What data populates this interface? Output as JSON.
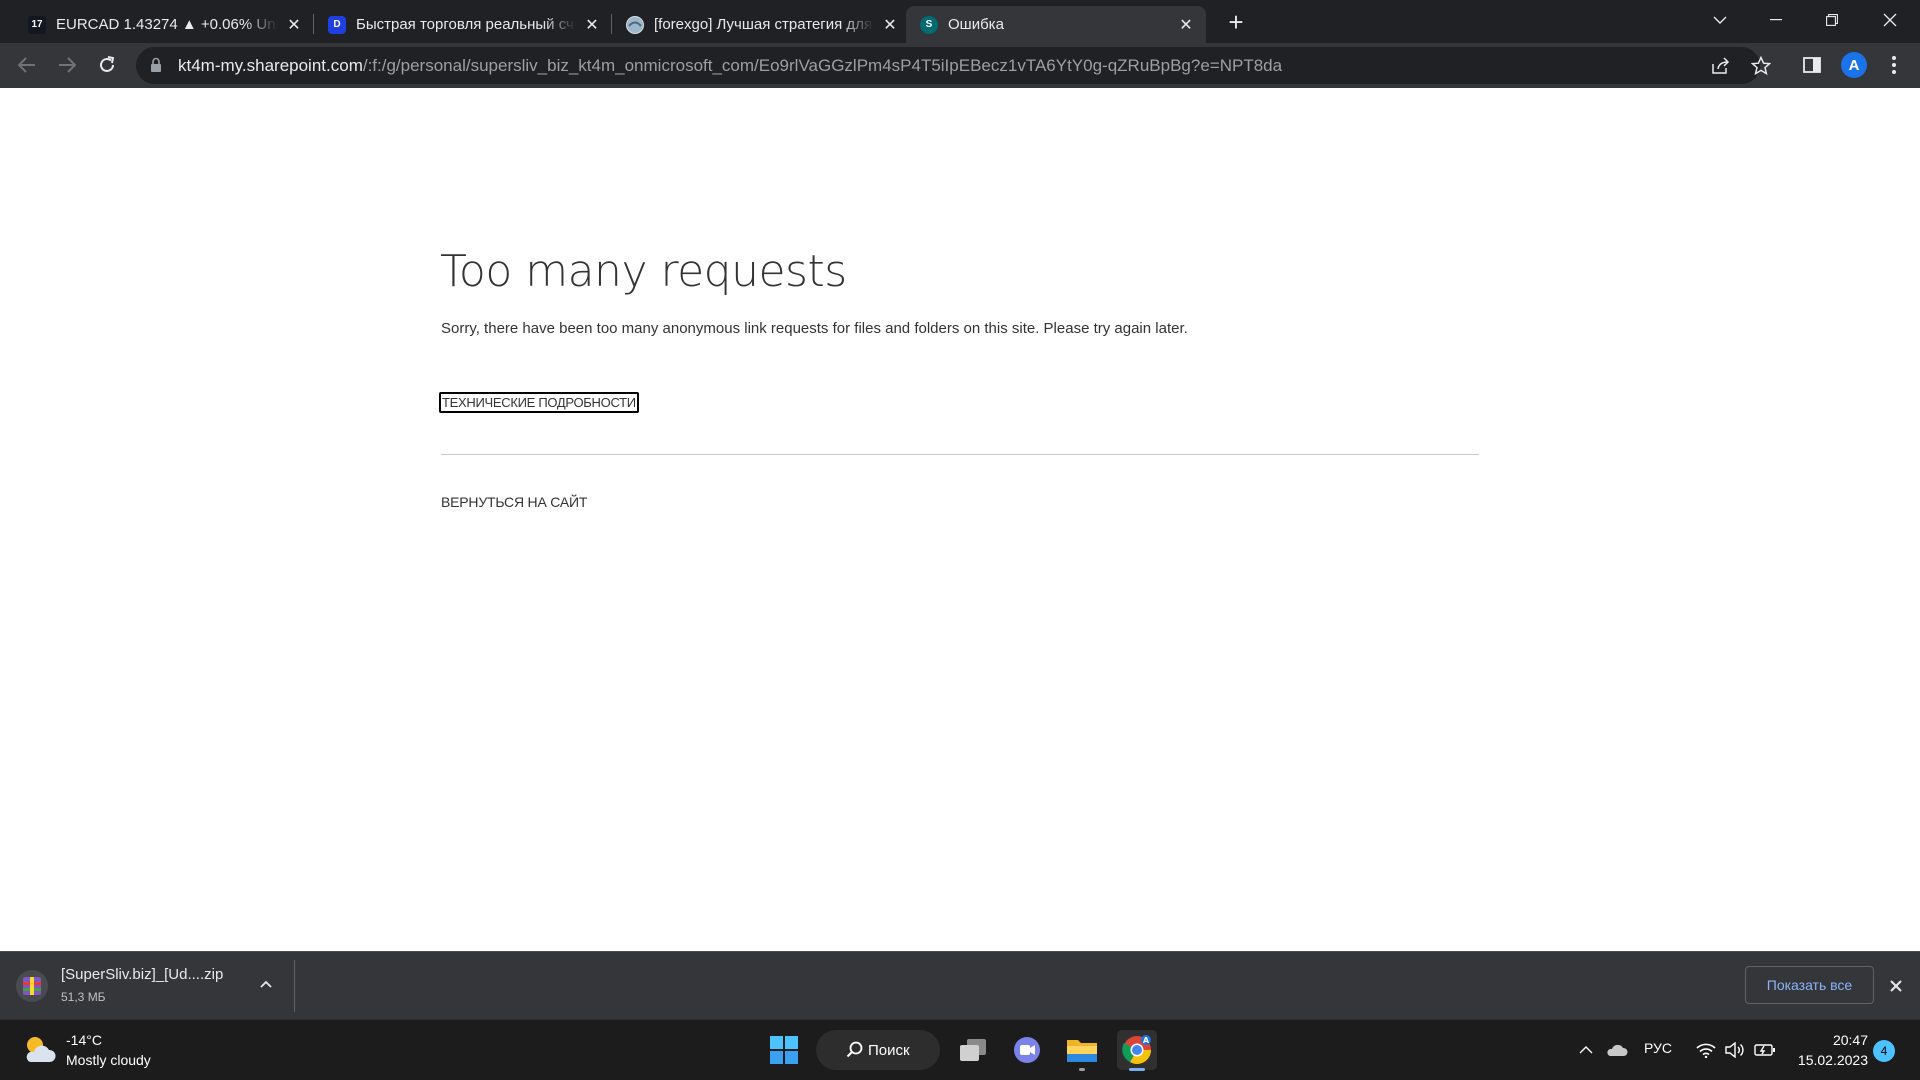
{
  "browser": {
    "tabs": [
      {
        "title": "EURCAD 1.43274 ▲ +0.06% Unnamed",
        "favicon": "tradingview-icon"
      },
      {
        "title": "Быстрая торговля реальный счёт",
        "favicon": "broker-icon"
      },
      {
        "title": "[forexgo] Лучшая стратегия для",
        "favicon": "forexgo-icon"
      },
      {
        "title": "Ошибка",
        "favicon": "sharepoint-icon"
      }
    ],
    "active_tab": 3,
    "url_host": "kt4m-my.sharepoint.com",
    "url_path": "/:f:/g/personal/supersliv_biz_kt4m_onmicrosoft_com/Eo9rlVaGGzlPm4sP4T5iIpEBecz1vTA6YtY0g-qZRuBpBg?e=NPT8da",
    "profile_initial": "A"
  },
  "page": {
    "title": "Too many requests",
    "message": "Sorry, there have been too many anonymous link requests for files and folders on this site. Please try again later.",
    "details_button": "ТЕХНИЧЕСКИЕ ПОДРОБНОСТИ",
    "back_link": "ВЕРНУТЬСЯ НА САЙТ"
  },
  "downloads": {
    "file_name": "[SuperSliv.biz]_[Ud....zip",
    "file_size": "51,3 МБ",
    "show_all": "Показать все"
  },
  "taskbar": {
    "weather_temp": "-14°C",
    "weather_condition": "Mostly cloudy",
    "search_label": "Поиск",
    "language": "РУС",
    "time": "20:47",
    "date": "15.02.2023",
    "notification_count": "4"
  },
  "colors": {
    "tabstrip": "#202124",
    "toolbar": "#35363a",
    "accent_blue": "#8ab4f8",
    "taskbar": "#1c1c1c"
  }
}
